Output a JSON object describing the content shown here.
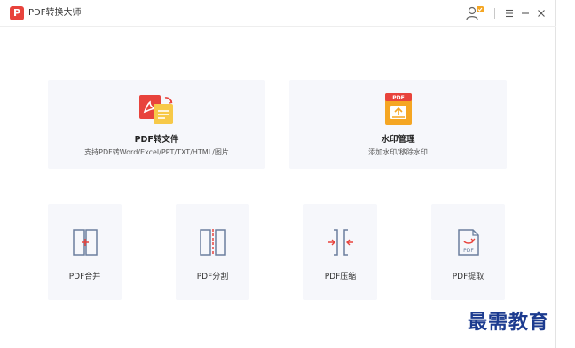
{
  "titlebar": {
    "app_title": "PDF转换大师",
    "logo_letter": "P"
  },
  "main": {
    "large_cards": [
      {
        "title": "PDF转文件",
        "description": "支持PDF转Word/Excel/PPT/TXT/HTML/图片",
        "icon": "pdf-convert-icon"
      },
      {
        "title": "水印管理",
        "description": "添加水印/移除水印",
        "icon": "watermark-icon",
        "icon_badge": "PDF"
      }
    ],
    "small_cards": [
      {
        "title": "PDF合并",
        "icon": "merge-icon"
      },
      {
        "title": "PDF分割",
        "icon": "split-icon"
      },
      {
        "title": "PDF压缩",
        "icon": "compress-icon"
      },
      {
        "title": "PDF提取",
        "icon": "extract-icon",
        "icon_badge": "PDF"
      }
    ]
  },
  "watermark_text": "最需教育",
  "colors": {
    "accent_red": "#e8433c",
    "accent_orange": "#f5a623",
    "accent_yellow": "#f7c948",
    "card_bg": "#f6f7fb",
    "watermark_blue": "#1c3b8f"
  }
}
